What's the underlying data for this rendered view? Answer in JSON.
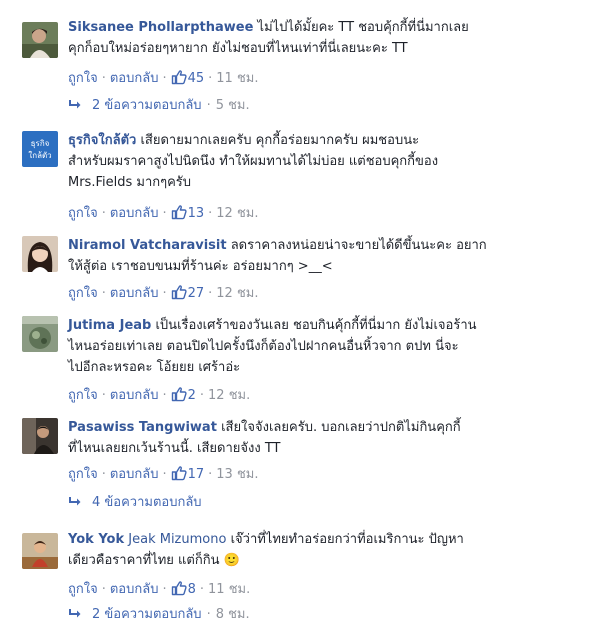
{
  "actions": {
    "like": "ถูกใจ",
    "reply": "ตอบกลับ",
    "sep": "·"
  },
  "comments": [
    {
      "author": "Siksanee Phollarpthawee",
      "line1": "ไม่ไปได้มั้ยคะ TT ชอบคุ้กกี้ที่นี่มากเลย",
      "line2": "คุกก็อบใหม่อร่อยๆหายาก ยังไม่ชอบที่ไหนเท่าที่นี่เลยนะคะ TT",
      "likes": "45",
      "time": "11 ชม.",
      "replies": "2 ข้อความตอบกลับ",
      "replies_time": "5 ชม."
    },
    {
      "author": "ธุรกิจใกล้ตัว",
      "avatar_text": [
        "ธุรกิจ",
        "ใกล้ตัว"
      ],
      "line1": "เสียดายมากเลยครับ คุกกี้อร่อยมากครับ ผมชอบนะ",
      "line2": "สำหรับผมราคาสูงไปนิดนึง ทำให้ผมทานได้ไม่บ่อย แต่ชอบคุกกี้ของ",
      "line3": "Mrs.Fields มากๆครับ",
      "likes": "13",
      "time": "12 ชม."
    },
    {
      "author": "Niramol Vatcharavisit",
      "line1": "ลดราคาลงหน่อยน่าจะขายได้ดีขึ้นนะคะ อยาก",
      "line2": "ให้สู้ต่อ เราชอบขนมที่ร้านค่ะ อร่อยมากๆ >__<",
      "likes": "27",
      "time": "12 ชม."
    },
    {
      "author": "Jutima Jeab",
      "line1": "เป็นเรื่องเศร้าของวันเลย ชอบกินคุ้กกี้ที่นี่มาก ยังไม่เจอร้าน",
      "line2": "ไหนอร่อยเท่าเลย ตอนปิดไปครั้งนึงก็ต้องไปฝากคนอื่นหิ้วจาก ตปท นี่จะ",
      "line3": "ไปอีกละหรอคะ โอ้ยยย เศร้าอ่ะ",
      "likes": "2",
      "time": "12 ชม."
    },
    {
      "author": "Pasawiss Tangwiwat",
      "line1": "เสียใจจังเลยครับ. บอกเลยว่าปกติไม่กินคุกกี้",
      "line2": "ที่ไหนเลยยกเว้นร้านนี้. เสียดายจังง TT",
      "likes": "17",
      "time": "13 ชม.",
      "replies": "4 ข้อความตอบกลับ"
    },
    {
      "author": "Yok Yok",
      "tag": "Jeak Mizumono",
      "line1": "เจ๊ว่าที่ไทยทำอร่อยกว่าที่อเมริกานะ ปัญหา",
      "line2": "เดียวคือราคาที่ไทย แต่ก็กิน 🙂",
      "likes": "8",
      "time": "11 ชม.",
      "replies": "2 ข้อความตอบกลับ",
      "replies_time": "8 ชม."
    }
  ],
  "colors": {
    "link": "#365899",
    "meta": "#90949c",
    "action": "#4267b2",
    "text": "#1d2129"
  }
}
